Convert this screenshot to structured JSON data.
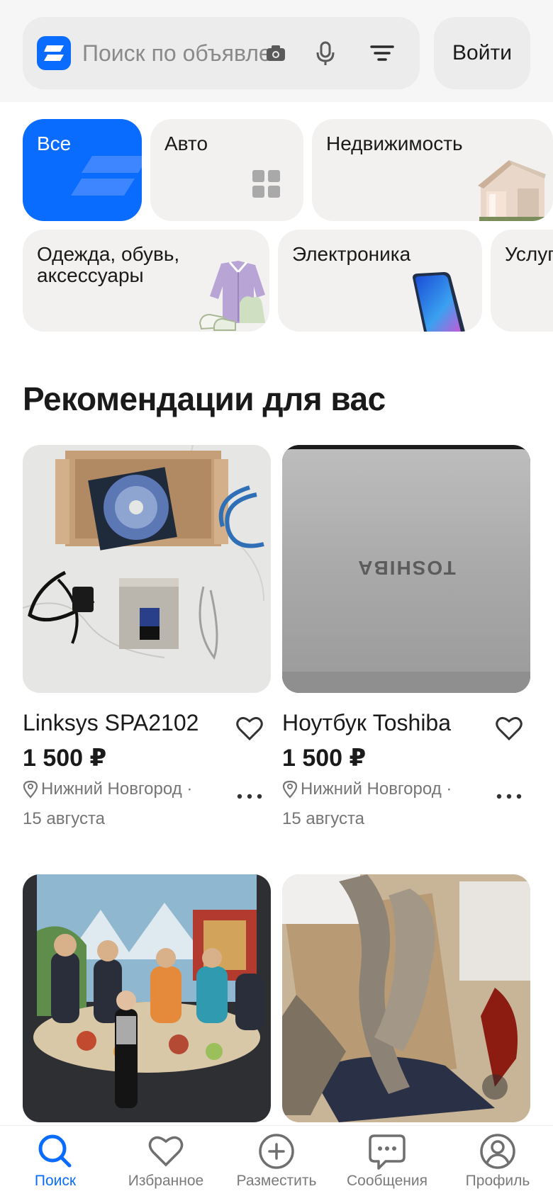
{
  "header": {
    "search_placeholder": "Поиск по объявлениям",
    "login_label": "Войти",
    "icons": [
      "camera-icon",
      "microphone-icon",
      "filter-icon"
    ]
  },
  "categories": [
    {
      "label": "Все",
      "icon": "brand-logo"
    },
    {
      "label": "Авто",
      "icon": "grid-icon"
    },
    {
      "label": "Недвижимость",
      "icon": "house-image"
    },
    {
      "label": "Одежда, обувь,\nаксессуары",
      "icon": "clothes-image"
    },
    {
      "label": "Электроника",
      "icon": "phone-image"
    },
    {
      "label": "Услуги",
      "icon": "services-image"
    }
  ],
  "section_title": "Рекомендации для вас",
  "listings": [
    {
      "title": "Linksys SPA2102",
      "price": "1 500 ₽",
      "location": "Нижний Новгород ·",
      "date": "15 августа"
    },
    {
      "title": "Ноутбук Toshiba",
      "price": "1 500 ₽",
      "location": "Нижний Новгород ·",
      "date": "15 августа",
      "photo_text": "TOSHIBA"
    },
    {
      "title": "",
      "price": "",
      "location": "",
      "date": ""
    },
    {
      "title": "",
      "price": "",
      "location": "",
      "date": ""
    }
  ],
  "bottom_nav": [
    {
      "label": "Поиск",
      "icon": "search-icon",
      "active": true
    },
    {
      "label": "Избранное",
      "icon": "heart-icon",
      "active": false
    },
    {
      "label": "Разместить",
      "icon": "plus-circle-icon",
      "active": false
    },
    {
      "label": "Сообщения",
      "icon": "chat-icon",
      "active": false
    },
    {
      "label": "Профиль",
      "icon": "profile-icon",
      "active": false
    }
  ],
  "colors": {
    "accent": "#0a6cff",
    "tile_bg": "#f2f1f0",
    "text_secondary": "#757575"
  }
}
